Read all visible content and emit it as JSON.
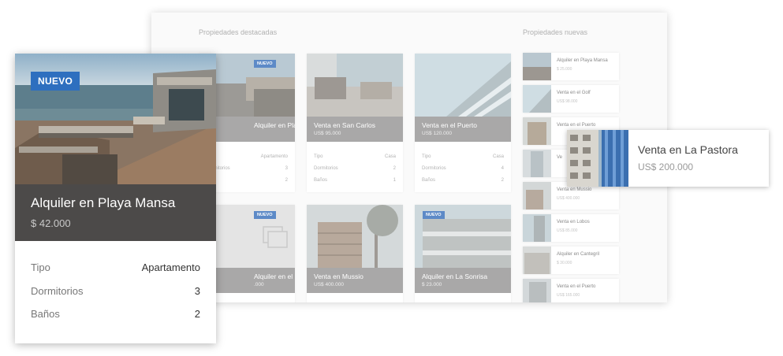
{
  "background_page": {
    "featured_title": "Propiedades destacadas",
    "new_title": "Propiedades nuevas",
    "grid_cards": [
      {
        "title": "Alquiler en Playa Mansa",
        "price": "",
        "badge": "NUEVO",
        "rows": [
          [
            "",
            "Apartamento"
          ],
          [
            "Dormitorios",
            "3"
          ],
          [
            "",
            "2"
          ]
        ]
      },
      {
        "title": "Venta en San Carlos",
        "price": "US$ 95.000",
        "badge": "",
        "rows": [
          [
            "Tipo",
            "Casa"
          ],
          [
            "Dormitorios",
            "2"
          ],
          [
            "Baños",
            "1"
          ]
        ]
      },
      {
        "title": "Venta en el Puerto",
        "price": "US$ 120.000",
        "badge": "",
        "rows": [
          [
            "Tipo",
            "Casa"
          ],
          [
            "Dormitorios",
            "4"
          ],
          [
            "Baños",
            "2"
          ]
        ]
      },
      {
        "title": "Alquiler en el Puerto",
        "price": ".000",
        "badge": "NUEVO",
        "rows": []
      },
      {
        "title": "Venta en Mussio",
        "price": "US$ 400.000",
        "badge": "",
        "rows": []
      },
      {
        "title": "Alquiler en La Sonrisa",
        "price": "$ 23.000",
        "badge": "NUEVO",
        "rows": []
      }
    ],
    "side_list": [
      {
        "title": "Alquiler en Playa Mansa",
        "price": "$ 25.000"
      },
      {
        "title": "Venta en el Golf",
        "price": "US$ 98.000"
      },
      {
        "title": "Venta en el Puerto",
        "price": ""
      },
      {
        "title": "Ve",
        "price": ""
      },
      {
        "title": "Venta en Mussio",
        "price": "US$ 400.000"
      },
      {
        "title": "Venta en Lobos",
        "price": "US$ 85.000"
      },
      {
        "title": "Alquiler en Cantegril",
        "price": "$ 30.000"
      },
      {
        "title": "Venta en el Puerto",
        "price": "US$ 165.000"
      }
    ]
  },
  "feature_card": {
    "badge": "NUEVO",
    "title": "Alquiler en Playa Mansa",
    "price": "$ 42.000",
    "specs": [
      {
        "label": "Tipo",
        "value": "Apartamento"
      },
      {
        "label": "Dormitorios",
        "value": "3"
      },
      {
        "label": "Baños",
        "value": "2"
      }
    ]
  },
  "hover_card": {
    "title": "Venta en La Pastora",
    "price": "US$ 200.000"
  },
  "colors": {
    "badge_blue": "#2e6fbf",
    "card_band_dark": "#4c4a49",
    "card_band_grey": "#a9a8a8"
  }
}
